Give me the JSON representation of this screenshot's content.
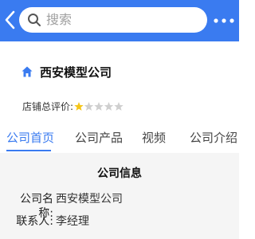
{
  "header": {
    "search_placeholder": "搜索",
    "back_icon": "chevron-left-icon",
    "search_icon": "search-icon",
    "more_icon": "more-dots-icon",
    "color": "#3a7bf0"
  },
  "store": {
    "icon": "home-icon",
    "name": "西安模型公司",
    "rating_label": "店铺总评价:",
    "rating": {
      "value": 1,
      "max": 5
    },
    "star_filled_color": "#f5c518",
    "star_empty_color": "#cfcfcf"
  },
  "tabs": [
    {
      "label": "公司首页",
      "active": true
    },
    {
      "label": "公司产品",
      "active": false
    },
    {
      "label": "视频",
      "active": false
    },
    {
      "label": "公司介绍",
      "active": false
    }
  ],
  "info": {
    "title": "公司信息",
    "rows": [
      {
        "label": "公司名称:",
        "value": "西安模型公司"
      },
      {
        "label": "联系人:",
        "value": "李经理"
      }
    ]
  }
}
